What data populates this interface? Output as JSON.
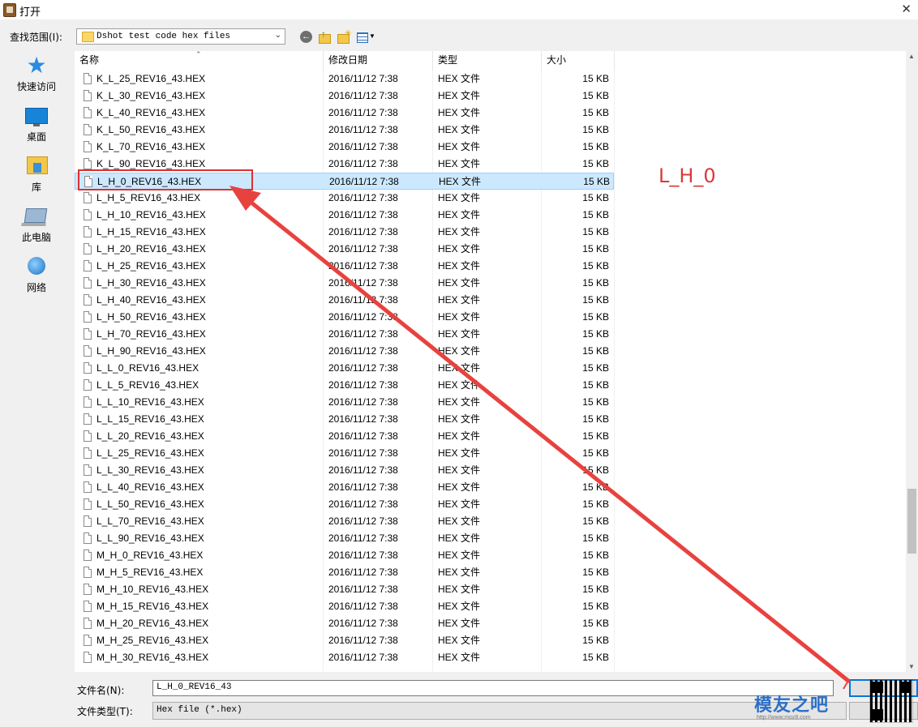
{
  "window": {
    "title": "打开",
    "close_glyph": "✕"
  },
  "toolbar": {
    "look_in_label": "查找范围(I):",
    "look_in_value": "Dshot test code hex files",
    "icons": [
      "back-icon",
      "up-folder-icon",
      "new-folder-icon",
      "view-menu-icon"
    ]
  },
  "places": [
    {
      "label": "快速访问",
      "icon": "quick-access-star-icon"
    },
    {
      "label": "桌面",
      "icon": "desktop-icon"
    },
    {
      "label": "库",
      "icon": "library-icon"
    },
    {
      "label": "此电脑",
      "icon": "computer-icon"
    },
    {
      "label": "网络",
      "icon": "network-icon"
    }
  ],
  "columns": {
    "name": "名称",
    "date": "修改日期",
    "type": "类型",
    "size": "大小"
  },
  "files": [
    {
      "name": "K_L_25_REV16_43.HEX",
      "date": "2016/11/12 7:38",
      "type": "HEX 文件",
      "size": "15 KB"
    },
    {
      "name": "K_L_30_REV16_43.HEX",
      "date": "2016/11/12 7:38",
      "type": "HEX 文件",
      "size": "15 KB"
    },
    {
      "name": "K_L_40_REV16_43.HEX",
      "date": "2016/11/12 7:38",
      "type": "HEX 文件",
      "size": "15 KB"
    },
    {
      "name": "K_L_50_REV16_43.HEX",
      "date": "2016/11/12 7:38",
      "type": "HEX 文件",
      "size": "15 KB"
    },
    {
      "name": "K_L_70_REV16_43.HEX",
      "date": "2016/11/12 7:38",
      "type": "HEX 文件",
      "size": "15 KB"
    },
    {
      "name": "K_L_90_REV16_43.HEX",
      "date": "2016/11/12 7:38",
      "type": "HEX 文件",
      "size": "15 KB"
    },
    {
      "name": "L_H_0_REV16_43.HEX",
      "date": "2016/11/12 7:38",
      "type": "HEX 文件",
      "size": "15 KB",
      "selected": true
    },
    {
      "name": "L_H_5_REV16_43.HEX",
      "date": "2016/11/12 7:38",
      "type": "HEX 文件",
      "size": "15 KB"
    },
    {
      "name": "L_H_10_REV16_43.HEX",
      "date": "2016/11/12 7:38",
      "type": "HEX 文件",
      "size": "15 KB"
    },
    {
      "name": "L_H_15_REV16_43.HEX",
      "date": "2016/11/12 7:38",
      "type": "HEX 文件",
      "size": "15 KB"
    },
    {
      "name": "L_H_20_REV16_43.HEX",
      "date": "2016/11/12 7:38",
      "type": "HEX 文件",
      "size": "15 KB"
    },
    {
      "name": "L_H_25_REV16_43.HEX",
      "date": "2016/11/12 7:38",
      "type": "HEX 文件",
      "size": "15 KB"
    },
    {
      "name": "L_H_30_REV16_43.HEX",
      "date": "2016/11/12 7:38",
      "type": "HEX 文件",
      "size": "15 KB"
    },
    {
      "name": "L_H_40_REV16_43.HEX",
      "date": "2016/11/12 7:38",
      "type": "HEX 文件",
      "size": "15 KB"
    },
    {
      "name": "L_H_50_REV16_43.HEX",
      "date": "2016/11/12 7:38",
      "type": "HEX 文件",
      "size": "15 KB"
    },
    {
      "name": "L_H_70_REV16_43.HEX",
      "date": "2016/11/12 7:38",
      "type": "HEX 文件",
      "size": "15 KB"
    },
    {
      "name": "L_H_90_REV16_43.HEX",
      "date": "2016/11/12 7:38",
      "type": "HEX 文件",
      "size": "15 KB"
    },
    {
      "name": "L_L_0_REV16_43.HEX",
      "date": "2016/11/12 7:38",
      "type": "HEX 文件",
      "size": "15 KB"
    },
    {
      "name": "L_L_5_REV16_43.HEX",
      "date": "2016/11/12 7:38",
      "type": "HEX 文件",
      "size": "15 KB"
    },
    {
      "name": "L_L_10_REV16_43.HEX",
      "date": "2016/11/12 7:38",
      "type": "HEX 文件",
      "size": "15 KB"
    },
    {
      "name": "L_L_15_REV16_43.HEX",
      "date": "2016/11/12 7:38",
      "type": "HEX 文件",
      "size": "15 KB"
    },
    {
      "name": "L_L_20_REV16_43.HEX",
      "date": "2016/11/12 7:38",
      "type": "HEX 文件",
      "size": "15 KB"
    },
    {
      "name": "L_L_25_REV16_43.HEX",
      "date": "2016/11/12 7:38",
      "type": "HEX 文件",
      "size": "15 KB"
    },
    {
      "name": "L_L_30_REV16_43.HEX",
      "date": "2016/11/12 7:38",
      "type": "HEX 文件",
      "size": "15 KB"
    },
    {
      "name": "L_L_40_REV16_43.HEX",
      "date": "2016/11/12 7:38",
      "type": "HEX 文件",
      "size": "15 KB"
    },
    {
      "name": "L_L_50_REV16_43.HEX",
      "date": "2016/11/12 7:38",
      "type": "HEX 文件",
      "size": "15 KB"
    },
    {
      "name": "L_L_70_REV16_43.HEX",
      "date": "2016/11/12 7:38",
      "type": "HEX 文件",
      "size": "15 KB"
    },
    {
      "name": "L_L_90_REV16_43.HEX",
      "date": "2016/11/12 7:38",
      "type": "HEX 文件",
      "size": "15 KB"
    },
    {
      "name": "M_H_0_REV16_43.HEX",
      "date": "2016/11/12 7:38",
      "type": "HEX 文件",
      "size": "15 KB"
    },
    {
      "name": "M_H_5_REV16_43.HEX",
      "date": "2016/11/12 7:38",
      "type": "HEX 文件",
      "size": "15 KB"
    },
    {
      "name": "M_H_10_REV16_43.HEX",
      "date": "2016/11/12 7:38",
      "type": "HEX 文件",
      "size": "15 KB"
    },
    {
      "name": "M_H_15_REV16_43.HEX",
      "date": "2016/11/12 7:38",
      "type": "HEX 文件",
      "size": "15 KB"
    },
    {
      "name": "M_H_20_REV16_43.HEX",
      "date": "2016/11/12 7:38",
      "type": "HEX 文件",
      "size": "15 KB"
    },
    {
      "name": "M_H_25_REV16_43.HEX",
      "date": "2016/11/12 7:38",
      "type": "HEX 文件",
      "size": "15 KB"
    },
    {
      "name": "M_H_30_REV16_43.HEX",
      "date": "2016/11/12 7:38",
      "type": "HEX 文件",
      "size": "15 KB"
    }
  ],
  "footer": {
    "file_name_label": "文件名(N):",
    "file_name_value": "L_H_0_REV16_43",
    "file_type_label": "文件类型(T):",
    "file_type_value": "Hex file (*.hex)"
  },
  "annotation": {
    "text": "L_H_0",
    "color": "#d93a3a"
  },
  "watermark": {
    "brand": "模友之吧",
    "url": "http://www.moz8.com"
  },
  "colors": {
    "selection_bg": "#cce8ff",
    "selection_border": "#99d1ff",
    "accent": "#0078d7"
  }
}
